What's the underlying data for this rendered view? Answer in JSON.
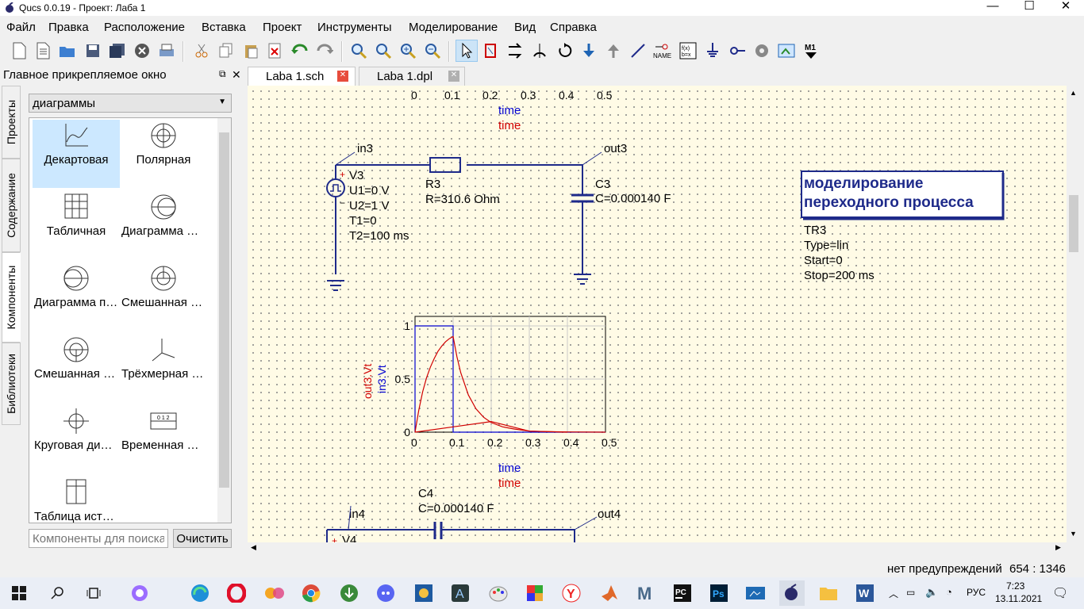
{
  "window": {
    "title": "Qucs 0.0.19 - Проект: Лаба 1",
    "minimize": "—",
    "maximize": "☐",
    "close": "✕"
  },
  "menu": [
    "Файл",
    "Правка",
    "Расположение",
    "Вставка",
    "Проект",
    "Инструменты",
    "Моделирование",
    "Вид",
    "Справка"
  ],
  "dock": {
    "title": "Главное прикрепляемое окно",
    "float_glyph": "⧉",
    "close_glyph": "✕",
    "side_tabs": [
      "Проекты",
      "Содержание",
      "Компоненты",
      "Библиотеки"
    ],
    "category": "диаграммы",
    "items": [
      {
        "label": "Декартовая",
        "icon": "cartesian-icon"
      },
      {
        "label": "Полярная",
        "icon": "polar-icon"
      },
      {
        "label": "Табличная",
        "icon": "tabular-icon"
      },
      {
        "label": "Диаграмма Смита",
        "icon": "smith-icon"
      },
      {
        "label": "Диаграмма полной проводимости",
        "icon": "admittance-smith-icon"
      },
      {
        "label": "Смешанная полярно-Смит",
        "icon": "polar-smith-icon"
      },
      {
        "label": "Смешанная Смит-полярная",
        "icon": "smith-polar-icon"
      },
      {
        "label": "Трёхмерная декартовая",
        "icon": "3d-cartesian-icon"
      },
      {
        "label": "Круговая диаграмма",
        "icon": "locus-icon"
      },
      {
        "label": "Временная диаграмма",
        "icon": "timing-icon"
      },
      {
        "label": "Таблица истинности",
        "icon": "truth-table-icon"
      }
    ],
    "search_placeholder": "Компоненты для поиска",
    "clear_label": "Очистить"
  },
  "tabs": [
    {
      "label": "Laba 1.sch",
      "active": true
    },
    {
      "label": "Laba 1.dpl",
      "active": false
    }
  ],
  "schematic": {
    "top_axis": {
      "ticks": [
        "0",
        "0.1",
        "0.2",
        "0.3",
        "0.4",
        "0.5"
      ],
      "label1": "time",
      "label2": "time"
    },
    "circuit1": {
      "node_in": "in3",
      "node_out": "out3",
      "source": {
        "name": "V3",
        "params": [
          "U1=0 V",
          "U2=1 V",
          "T1=0",
          "T2=100 ms"
        ]
      },
      "resistor": {
        "name": "R3",
        "value": "R=310.6 Ohm"
      },
      "capacitor": {
        "name": "C3",
        "value": "C=0.000140 F"
      }
    },
    "sim_box": {
      "line1": "моделирование",
      "line2": "переходного процесса"
    },
    "tran": {
      "name": "TR3",
      "params": [
        "Type=lin",
        "Start=0",
        "Stop=200 ms"
      ]
    },
    "circuit2": {
      "node_in": "in4",
      "node_out": "out4",
      "source_name": "V4",
      "capacitor": {
        "name": "C4",
        "value": "C=0.000140 F"
      }
    }
  },
  "chart_data": {
    "type": "line",
    "title": "",
    "xlabel": "time",
    "xlabel2": "time",
    "ylabel": "in3.Vt",
    "ylabel2": "out3.Vt",
    "xlim": [
      0,
      0.5
    ],
    "ylim": [
      0,
      1
    ],
    "x_ticks": [
      "0",
      "0.1",
      "0.2",
      "0.3",
      "0.4",
      "0.5"
    ],
    "y_ticks": [
      "0",
      "0.5",
      "1"
    ],
    "grid": true,
    "colors": {
      "in3.Vt": "#0000d0",
      "out3.Vt": "#d00000"
    },
    "series": [
      {
        "name": "in3.Vt",
        "x": [
          0,
          0,
          0.1,
          0.1,
          0.5
        ],
        "y": [
          0,
          1,
          1,
          0,
          0
        ]
      },
      {
        "name": "out3.Vt",
        "x": [
          0,
          0.01,
          0.02,
          0.03,
          0.04,
          0.05,
          0.06,
          0.07,
          0.08,
          0.09,
          0.1,
          0.11,
          0.12,
          0.14,
          0.16,
          0.18,
          0.2,
          0.23,
          0.26,
          0.3,
          0.35,
          0.4,
          0.5
        ],
        "y": [
          0,
          0.21,
          0.38,
          0.51,
          0.61,
          0.69,
          0.76,
          0.81,
          0.85,
          0.88,
          0.9,
          0.71,
          0.56,
          0.35,
          0.22,
          0.14,
          0.09,
          0.05,
          0.03,
          0.01,
          0.005,
          0.002,
          0
        ]
      },
      {
        "name": "out3.Vt",
        "x": [
          0,
          0.1,
          0.2,
          0.3,
          0.4
        ],
        "y": [
          0,
          0.05,
          0.1,
          0.01,
          0
        ]
      }
    ]
  },
  "status": {
    "warnings": "нет предупреждений",
    "coords": "654 : 1346"
  },
  "taskbar": {
    "lang": "РУС",
    "time": "7:23",
    "date": "13.11.2021",
    "apps": [
      "windows-start-icon",
      "search-icon",
      "task-view-icon",
      "cortana-icon",
      "edge-icon",
      "opera-icon",
      "multicolor-app-icon",
      "chrome-icon",
      "green-app-icon",
      "discord-icon",
      "settings-app-icon",
      "atom-a-icon",
      "paint-icon",
      "colorful-app-icon",
      "yandex-icon",
      "matlab-icon",
      "maple-m-icon",
      "pycharm-icon",
      "photoshop-icon",
      "video-editor-icon",
      "qucs-icon",
      "folder-icon",
      "word-icon"
    ]
  }
}
